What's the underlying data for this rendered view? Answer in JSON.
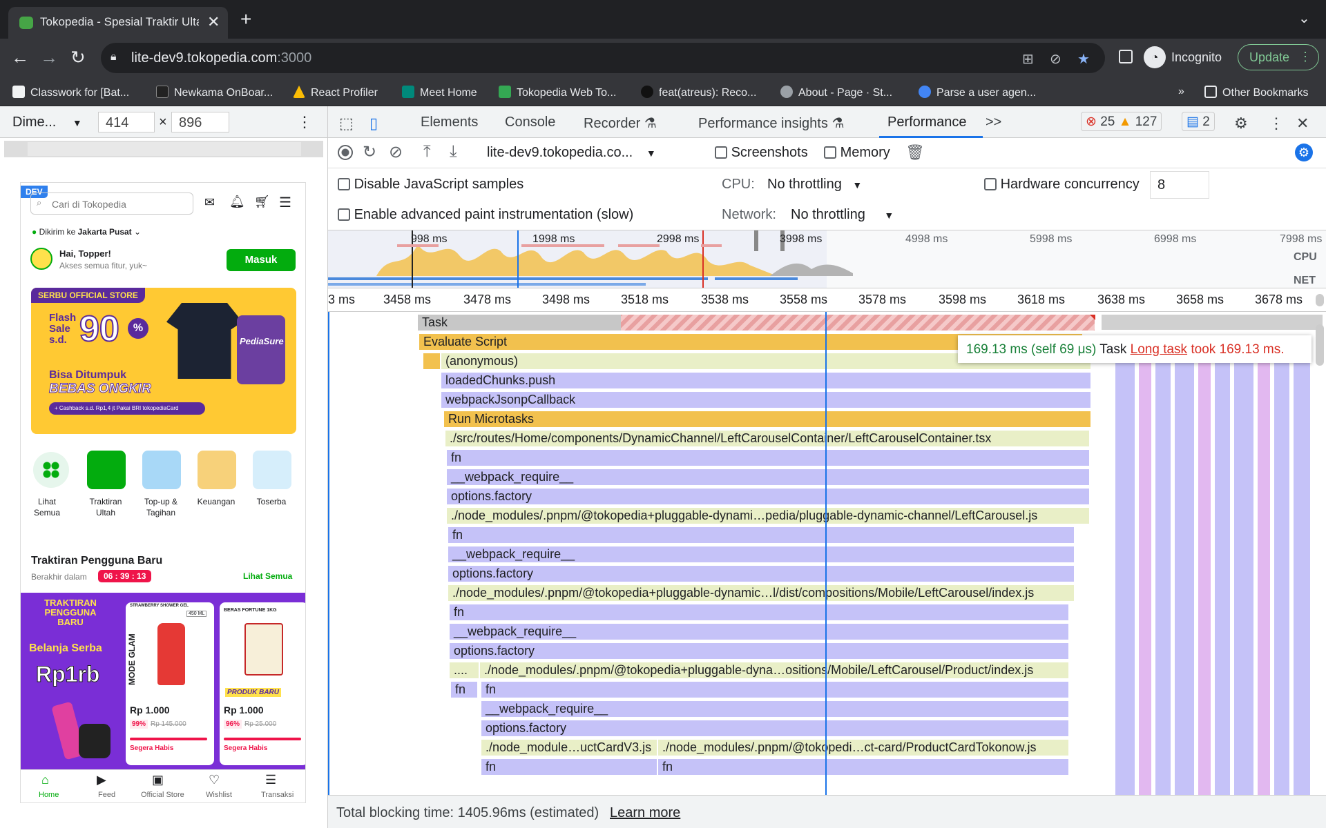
{
  "browser": {
    "tab_title": "Tokopedia - Spesial Traktir Ulta",
    "url_host": "lite-dev9.tokopedia.com",
    "url_port": ":3000",
    "profile_label": "Incognito",
    "update_label": "Update",
    "bookmarks": [
      "Classwork for [Bat...",
      "Newkama OnBoar...",
      "React Profiler",
      "Meet Home",
      "Tokopedia Web To...",
      "feat(atreus): Reco...",
      "About - Page · St...",
      "Parse a user agen..."
    ],
    "other_bookmarks": "Other Bookmarks"
  },
  "device_toolbar": {
    "device": "Dime...",
    "width": "414",
    "height": "896",
    "times": "×"
  },
  "mobile": {
    "dev_badge": "DEV",
    "search_placeholder": "Cari di Tokopedia",
    "location_prefix": "Dikirim ke",
    "location_city": "Jakarta Pusat",
    "greeting": "Hai, Topper!",
    "greeting_sub": "Akses semua fitur, yuk~",
    "login_button": "Masuk",
    "banner": {
      "store_tag": "SERBU OFFICIAL STORE",
      "flash": "Flash\nSale\ns.d.",
      "percent": "90",
      "pct_sign": "%",
      "stack": "Bisa Ditumpuk",
      "free": "BEBAS ONGKIR",
      "cashback": "+ Cashback s.d. Rp1,4 jt",
      "pay": "Pakai BRI tokopediaCard",
      "brand": "PediaSure"
    },
    "categories": [
      {
        "label": "Lihat\nSemua"
      },
      {
        "label": "Traktiran\nUltah"
      },
      {
        "label": "Top-up &\nTagihan"
      },
      {
        "label": "Keuangan"
      },
      {
        "label": "Toserba"
      }
    ],
    "section_title": "Traktiran Pengguna Baru",
    "ends_label": "Berakhir dalam",
    "countdown": "06 : 39 : 13",
    "see_all": "Lihat Semua",
    "promo_banner": {
      "brand": "TRAKTIRAN PENGGUNA BARU",
      "line1": "Belanja Serba",
      "price": "Rp1rb"
    },
    "products": [
      {
        "tag": "STRAWBERRY SHOWER GEL",
        "size": "450 ML",
        "brand": "MODE GLAM",
        "price": "Rp 1.000",
        "discount": "99%",
        "old_price": "Rp 145.000",
        "status": "Segera Habis"
      },
      {
        "tag": "BERAS FORTUNE 1KG",
        "brand": "PRODUK BARU",
        "price": "Rp 1.000",
        "discount": "96%",
        "old_price": "Rp 25.000",
        "status": "Segera Habis"
      }
    ],
    "bottom_nav": [
      "Home",
      "Feed",
      "Official Store",
      "Wishlist",
      "Transaksi"
    ]
  },
  "devtools": {
    "tabs": [
      "Elements",
      "Console",
      "Recorder",
      "Performance insights",
      "Performance"
    ],
    "more": ">>",
    "errors": "25",
    "warnings": "127",
    "messages": "2",
    "profile_select": "lite-dev9.tokopedia.co...",
    "screenshots_label": "Screenshots",
    "memory_label": "Memory",
    "disable_js_samples": "Disable JavaScript samples",
    "advanced_paint": "Enable advanced paint instrumentation (slow)",
    "cpu_label": "CPU:",
    "cpu_value": "No throttling",
    "network_label": "Network:",
    "network_value": "No throttling",
    "hw_label": "Hardware concurrency",
    "hw_value": "8",
    "overview_ticks": [
      "998 ms",
      "1998 ms",
      "2998 ms",
      "3998 ms",
      "4998 ms",
      "5998 ms",
      "6998 ms",
      "7998 ms"
    ],
    "cpu_track": "CPU",
    "net_track": "NET",
    "ruler_ticks": [
      "3 ms",
      "3458 ms",
      "3478 ms",
      "3498 ms",
      "3518 ms",
      "3538 ms",
      "3558 ms",
      "3578 ms",
      "3598 ms",
      "3618 ms",
      "3638 ms",
      "3658 ms",
      "3678 ms"
    ],
    "flame_rows": [
      "Task",
      "Evaluate Script",
      "(anonymous)",
      "loadedChunks.push",
      "webpackJsonpCallback",
      "Run Microtasks",
      "./src/routes/Home/components/DynamicChannel/LeftCarouselContainer/LeftCarouselContainer.tsx",
      "fn",
      "__webpack_require__",
      "options.factory",
      "./node_modules/.pnpm/@tokopedia+pluggable-dynami…pedia/pluggable-dynamic-channel/LeftCarousel.js",
      "fn",
      "__webpack_require__",
      "options.factory",
      "./node_modules/.pnpm/@tokopedia+pluggable-dynamic…l/dist/compositions/Mobile/LeftCarousel/index.js",
      "fn",
      "__webpack_require__",
      "options.factory",
      "./node_modules/.pnpm/@tokopedia+pluggable-dyna…ositions/Mobile/LeftCarousel/Product/index.js",
      "fn",
      "__webpack_require__",
      "options.factory",
      "./node_module…uctCardV3.js",
      "fn"
    ],
    "flame_extra": {
      "ellipsis": "....",
      "fn2": "fn",
      "product_card": "./node_modules/.pnpm/@tokopedi…ct-card/ProductCardTokonow.js",
      "fn3": "fn"
    },
    "tooltip": {
      "duration": "169.13 ms (self 69 μs)",
      "label": "Task",
      "link": "Long task",
      "rest": "took 169.13 ms."
    },
    "footer_text": "Total blocking time: 1405.96ms (estimated)",
    "footer_link": "Learn more"
  },
  "colors": {
    "accent_green": "#03ac0e",
    "devtools_blue": "#1a73e8",
    "long_task_red": "#d93025",
    "script_yellow": "#f2c14e",
    "purple": "#c5c2f8"
  }
}
